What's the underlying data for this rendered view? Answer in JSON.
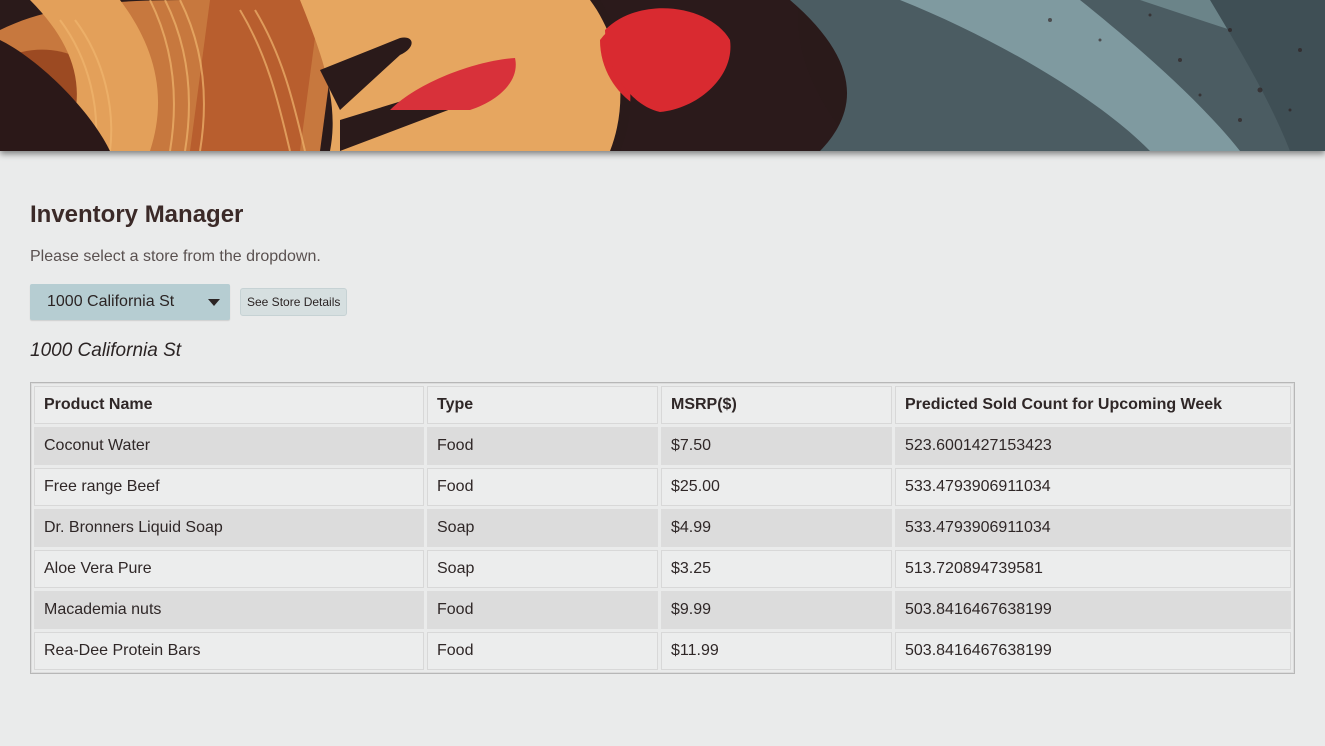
{
  "page": {
    "title": "Inventory Manager",
    "instructions": "Please select a store from the dropdown.",
    "colors": {
      "background": "#eaebeb",
      "select": "#b6cdd2",
      "heading": "#3b2a28"
    }
  },
  "controls": {
    "store_select": {
      "selected": "1000 California St"
    },
    "details_button": "See Store Details"
  },
  "store_heading": "1000 California St",
  "table": {
    "headers": [
      "Product Name",
      "Type",
      "MSRP($)",
      "Predicted Sold Count for Upcoming Week"
    ],
    "rows": [
      [
        "Coconut Water",
        "Food",
        "$7.50",
        "523.6001427153423"
      ],
      [
        "Free range Beef",
        "Food",
        "$25.00",
        "533.4793906911034"
      ],
      [
        "Dr. Bronners Liquid Soap",
        "Soap",
        "$4.99",
        "533.4793906911034"
      ],
      [
        "Aloe Vera Pure",
        "Soap",
        "$3.25",
        "513.720894739581"
      ],
      [
        "Macademia nuts",
        "Food",
        "$9.99",
        "503.8416467638199"
      ],
      [
        "Rea-Dee Protein Bars",
        "Food",
        "$11.99",
        "503.8416467638199"
      ]
    ]
  }
}
